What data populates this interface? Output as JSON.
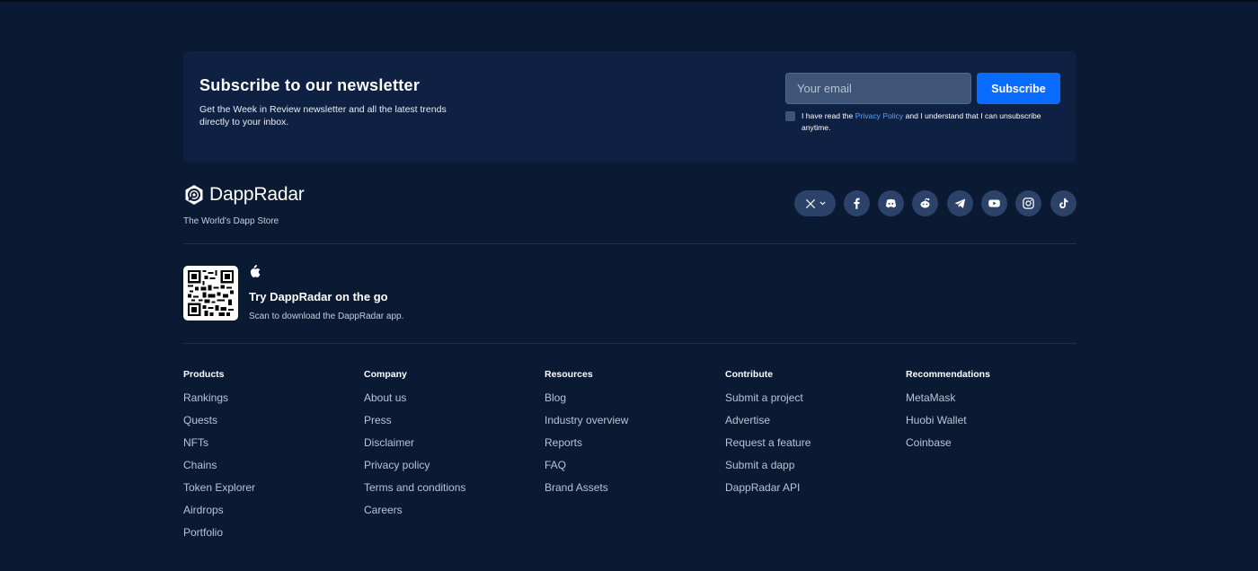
{
  "newsletter": {
    "title": "Subscribe to our newsletter",
    "description": "Get the Week in Review newsletter and all the latest trends directly to your inbox.",
    "email_placeholder": "Your email",
    "subscribe_label": "Subscribe",
    "consent_prefix": "I have read the",
    "consent_link": "Privacy Policy",
    "consent_suffix": "and I understand that I can unsubscribe anytime."
  },
  "brand": {
    "name": "DappRadar",
    "tagline": "The World's Dapp Store"
  },
  "socials": [
    "x-icon",
    "facebook-icon",
    "discord-icon",
    "reddit-icon",
    "telegram-icon",
    "youtube-icon",
    "instagram-icon",
    "tiktok-icon"
  ],
  "app": {
    "title": "Try DappRadar on the go",
    "description": "Scan to download the DappRadar app."
  },
  "columns": [
    {
      "heading": "Products",
      "links": [
        "Rankings",
        "Quests",
        "NFTs",
        "Chains",
        "Token Explorer",
        "Airdrops",
        "Portfolio"
      ]
    },
    {
      "heading": "Company",
      "links": [
        "About us",
        "Press",
        "Disclaimer",
        "Privacy policy",
        "Terms and conditions",
        "Careers"
      ]
    },
    {
      "heading": "Resources",
      "links": [
        "Blog",
        "Industry overview",
        "Reports",
        "FAQ",
        "Brand Assets"
      ]
    },
    {
      "heading": "Contribute",
      "links": [
        "Submit a project",
        "Advertise",
        "Request a feature",
        "Submit a dapp",
        "DappRadar API"
      ]
    },
    {
      "heading": "Recommendations",
      "links": [
        "MetaMask",
        "Huobi Wallet",
        "Coinbase"
      ]
    }
  ],
  "colors": {
    "background": "#0b1a33",
    "panel": "#0f2142",
    "accent": "#0a6cff",
    "link": "#5aa0ff"
  }
}
